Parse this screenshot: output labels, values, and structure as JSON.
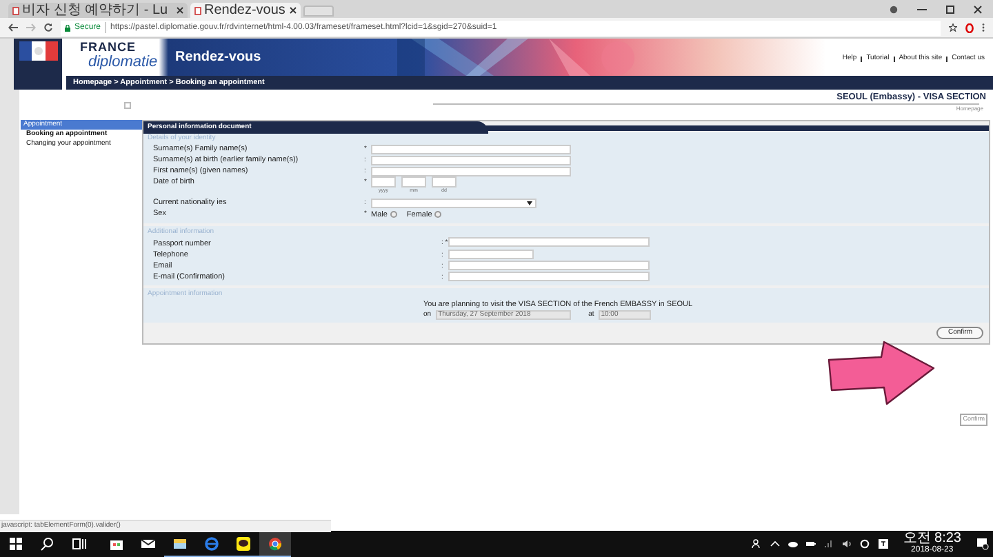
{
  "browser": {
    "tabs": [
      {
        "title": "비자 신청 예약하기 - Lu",
        "selected": false
      },
      {
        "title": "Rendez-vous",
        "selected": true
      }
    ],
    "secure_label": "Secure",
    "url": "https://pastel.diplomatie.gouv.fr/rdvinternet/html-4.00.03/frameset/frameset.html?lcid=1&sgid=270&suid=1"
  },
  "site": {
    "brand_top": "FRANCE",
    "brand_bottom": "diplomatie",
    "banner_title": "Rendez-vous",
    "header_links": [
      "Help",
      "Tutorial",
      "About this site",
      "Contact us"
    ],
    "breadcrumb": "Homepage > Appointment > Booking an appointment",
    "section_title": "SEOUL (Embassy) - VISA SECTION",
    "homepage_link": "Homepage"
  },
  "sidebar": {
    "header": "Appointment",
    "items": [
      {
        "label": "Booking an appointment",
        "selected": true
      },
      {
        "label": "Changing your appointment",
        "selected": false
      }
    ]
  },
  "form": {
    "title": "Personal information document",
    "sections": [
      {
        "title": "Details of your identity",
        "fields": [
          {
            "kind": "text",
            "label": "Surname(s) Family name(s)",
            "marker": "*"
          },
          {
            "kind": "text",
            "label": "Surname(s) at birth (earlier family name(s))",
            "marker": ":"
          },
          {
            "kind": "text",
            "label": "First name(s) (given names)",
            "marker": ":"
          },
          {
            "kind": "date",
            "label": "Date of birth",
            "marker": "*",
            "hints": [
              "yyyy",
              "mm",
              "dd"
            ]
          },
          {
            "kind": "select",
            "label": "Current nationality ies",
            "marker": ":"
          },
          {
            "kind": "radio",
            "label": "Sex",
            "marker": "*",
            "options": [
              {
                "label": "Male",
                "checked": false
              },
              {
                "label": "Female",
                "checked": false
              }
            ]
          }
        ]
      },
      {
        "title": "Additional information",
        "fields": [
          {
            "kind": "text",
            "label": "Passport number",
            "marker": ": *"
          },
          {
            "kind": "short",
            "label": "Telephone",
            "marker": ":"
          },
          {
            "kind": "text",
            "label": "Email",
            "marker": ":"
          },
          {
            "kind": "text",
            "label": "E-mail (Confirmation)",
            "marker": ":"
          }
        ]
      }
    ],
    "appointment": {
      "title": "Appointment information",
      "sentence": "You are planning to visit the VISA SECTION of the French EMBASSY in SEOUL",
      "on_label": "on",
      "date": "Thursday, 27 September 2018",
      "at_label": "at",
      "time": "10:00"
    },
    "confirm_button": "Confirm",
    "tooltip": "Confirm"
  },
  "status_text": "javascript: tabElementForm(0).valider()",
  "clock": {
    "time": "오전 8:23",
    "date": "2018-08-23"
  }
}
